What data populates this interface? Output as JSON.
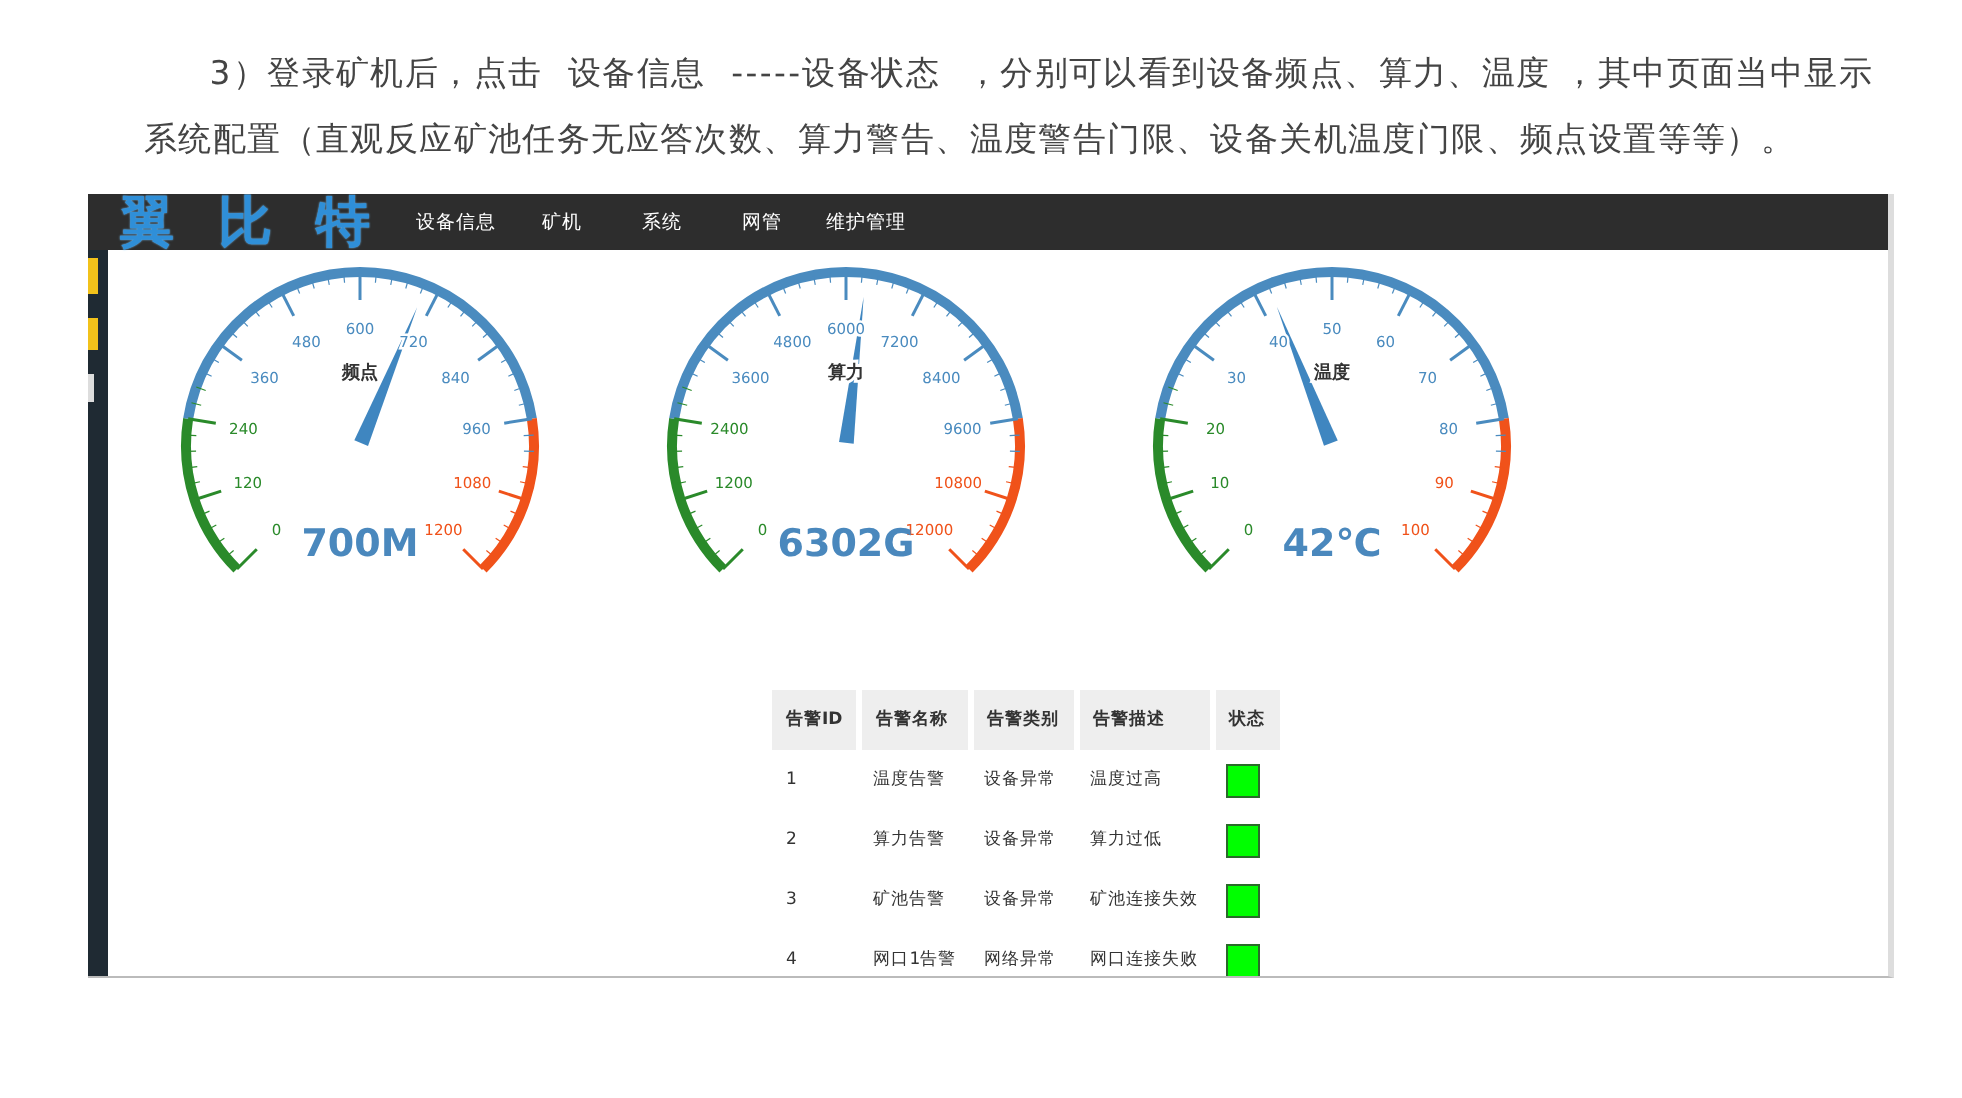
{
  "article": {
    "paragraph": "3）登录矿机后，点击  设备信息  -----设备状态  ，分别可以看到设备频点、算力、温度 ，其中页面当中显示系统配置（直观反应矿池任务无应答次数、算力警告、温度警告门限、设备关机温度门限、频点设置等等）。"
  },
  "screenshot": {
    "logo": "翼比特",
    "nav": [
      "设备信息",
      "矿机",
      "系统",
      "网管",
      "维护管理"
    ],
    "gauges": [
      {
        "title": "频点",
        "reading": "700M",
        "level": 0.583,
        "ticks": [
          "0",
          "120",
          "240",
          "360",
          "480",
          "600",
          "720",
          "840",
          "960",
          "1080",
          "1200"
        ]
      },
      {
        "title": "算力",
        "reading": "6302G",
        "level": 0.525,
        "ticks": [
          "0",
          "1200",
          "2400",
          "3600",
          "4800",
          "6000",
          "7200",
          "8400",
          "9600",
          "10800",
          "12000"
        ]
      },
      {
        "title": "温度",
        "reading": "42℃",
        "level": 0.42,
        "ticks": [
          "0",
          "10",
          "20",
          "30",
          "40",
          "50",
          "60",
          "70",
          "80",
          "90",
          "100"
        ]
      }
    ],
    "table": {
      "columns": [
        "告警ID",
        "告警名称",
        "告警类别",
        "告警描述",
        "状态"
      ],
      "rows": [
        {
          "id": "1",
          "name": "温度告警",
          "category": "设备异常",
          "description": "温度过高",
          "color": "#00ff00"
        },
        {
          "id": "2",
          "name": "算力告警",
          "category": "设备异常",
          "description": "算力过低",
          "color": "#00ff00"
        },
        {
          "id": "3",
          "name": "矿池告警",
          "category": "设备异常",
          "description": "矿池连接失效",
          "color": "#00ff00"
        },
        {
          "id": "4",
          "name": "网口1告警",
          "category": "网络异常",
          "description": "网口连接失败",
          "color": "#00ff00"
        }
      ]
    }
  }
}
